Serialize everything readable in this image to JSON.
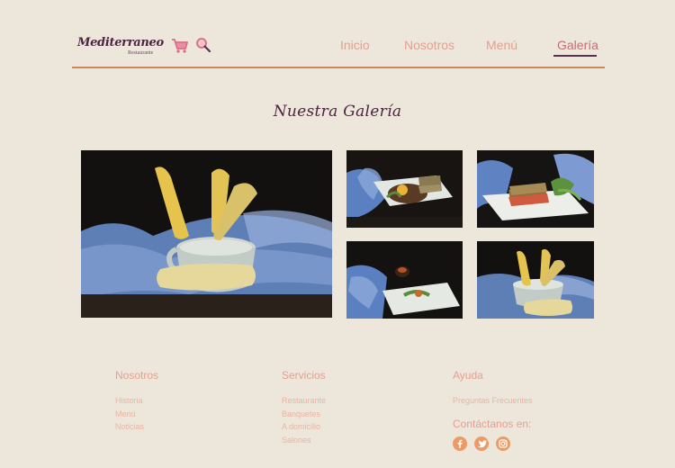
{
  "header": {
    "logo": {
      "name": "Mediterraneo",
      "subtitle": "Restaurante"
    },
    "icons": {
      "cart": "cart-icon",
      "search": "search-icon"
    },
    "nav": [
      {
        "label": "Inicio"
      },
      {
        "label": "Nosotros"
      },
      {
        "label": "Menú"
      },
      {
        "label": "Galería",
        "active": true
      }
    ]
  },
  "main": {
    "title": "Nuestra Galería",
    "photos": [
      {
        "subject": "corn in white mug on blue checkered cloth"
      },
      {
        "subject": "sandwich on plate with blue cloth"
      },
      {
        "subject": "sandwich with greens on white plate"
      },
      {
        "subject": "dish with sauce on white plate"
      },
      {
        "subject": "corn in white mug"
      }
    ]
  },
  "footer": {
    "nosotros": {
      "heading": "Nosotros",
      "links": [
        "Historia",
        "Menú",
        "Noticias"
      ]
    },
    "servicios": {
      "heading": "Servicios",
      "links": [
        "Restaurante",
        "Banquetes",
        "A domicilio",
        "Salones"
      ]
    },
    "ayuda": {
      "heading": "Ayuda",
      "links": [
        "Preguntas Frecuentes"
      ]
    },
    "contact": {
      "heading": "Contáctanos en:",
      "social": [
        "facebook-icon",
        "twitter-icon",
        "instagram-icon"
      ]
    }
  },
  "colors": {
    "background": "#ede6da",
    "nav_text": "#e59f91",
    "accent_dark": "#5a2f56",
    "rule": "#c9875b",
    "social": "#ed9a64"
  }
}
